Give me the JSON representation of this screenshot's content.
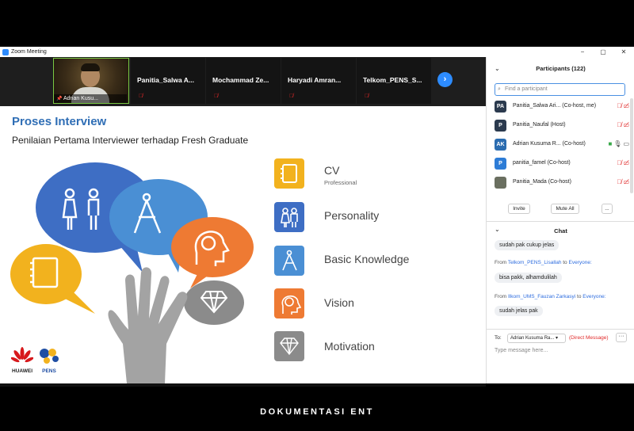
{
  "window": {
    "title": "Zoom Meeting",
    "min": "−",
    "max": "▢",
    "close": "✕"
  },
  "strip": {
    "self": {
      "name": "Adrian Kusu..."
    },
    "tiles": [
      "Panitia_Salwa A...",
      "Mochammad Ze...",
      "Haryadi Amran...",
      "Telkom_PENS_S..."
    ],
    "next": "›"
  },
  "slide": {
    "title": "Proses Interview",
    "subtitle": "Penilaian Pertama Interviewer terhadap Fresh Graduate",
    "categories": [
      {
        "label": "CV",
        "sub": "Professional",
        "color": "#f2b21e"
      },
      {
        "label": "Personality",
        "sub": "",
        "color": "#3e6ec4"
      },
      {
        "label": "Basic Knowledge",
        "sub": "",
        "color": "#4a8fd4"
      },
      {
        "label": "Vision",
        "sub": "",
        "color": "#ee7a33"
      },
      {
        "label": "Motivation",
        "sub": "",
        "color": "#8b8b8b"
      }
    ],
    "logos": {
      "huawei": "HUAWEI",
      "pens": "PENS"
    }
  },
  "participants": {
    "title": "Participants (122)",
    "search_placeholder": "Find a participant",
    "list": [
      {
        "initials": "PA",
        "name": "Panitia_Salwa Ari... (Co-host, me)",
        "color": "#2b3a4e"
      },
      {
        "initials": "P",
        "name": "Panitia_Naufal (Host)",
        "color": "#2b3a4e"
      },
      {
        "initials": "AK",
        "name": "Adrian Kusuma R... (Co-host)",
        "color": "#2b6cb0"
      },
      {
        "initials": "P",
        "name": "panitia_famel (Co-host)",
        "color": "#2d7cd6"
      },
      {
        "initials": "",
        "name": "Panitia_Mada (Co-host)",
        "color": "#6a6f60"
      }
    ],
    "invite": "Invite",
    "mute_all": "Mute All",
    "more": "..."
  },
  "chat": {
    "title": "Chat",
    "messages": [
      {
        "from": "",
        "to": "",
        "text": "sudah pak cukup jelas"
      },
      {
        "from": "Telkom_PENS_Lisallah",
        "to": "Everyone:",
        "text": "bisa pakk, alhamdulilah"
      },
      {
        "from": "Ilkom_UMS_Fauzan Zarkasyi",
        "to": "Everyone:",
        "text": "sudah jelas pak"
      }
    ],
    "from_prefix": "From",
    "to_word": "to",
    "to_label": "To:",
    "recipient": "Adrian Kusuma Ra... ▾",
    "direct": "(Direct Message)",
    "placeholder": "Type message here..."
  },
  "banner": "DOKUMENTASI ENT"
}
